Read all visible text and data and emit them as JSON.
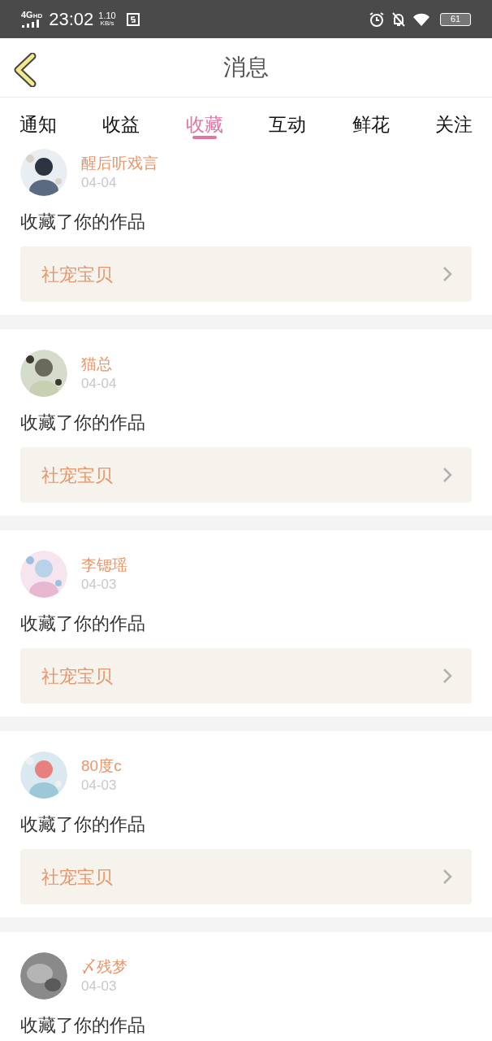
{
  "status_bar": {
    "network": "4G",
    "network_sub": "HD",
    "time": "23:02",
    "speed_value": "1.10",
    "speed_unit": "KB/s",
    "battery": "61"
  },
  "header": {
    "title": "消息"
  },
  "tabs": [
    {
      "label": "通知",
      "selected": false
    },
    {
      "label": "收益",
      "selected": false
    },
    {
      "label": "收藏",
      "selected": true
    },
    {
      "label": "互动",
      "selected": false
    },
    {
      "label": "鲜花",
      "selected": false
    },
    {
      "label": "关注",
      "selected": false
    }
  ],
  "messages": [
    {
      "user": "醒后听戏言",
      "date": "04-04",
      "action": "收藏了你的作品",
      "work": "社宠宝贝"
    },
    {
      "user": "猫总",
      "date": "04-04",
      "action": "收藏了你的作品",
      "work": "社宠宝贝"
    },
    {
      "user": "李锶瑶",
      "date": "04-03",
      "action": "收藏了你的作品",
      "work": "社宠宝贝"
    },
    {
      "user": "80度c",
      "date": "04-03",
      "action": "收藏了你的作品",
      "work": "社宠宝贝"
    },
    {
      "user": "〆残梦",
      "date": "04-03",
      "action": "收藏了你的作品"
    }
  ]
}
